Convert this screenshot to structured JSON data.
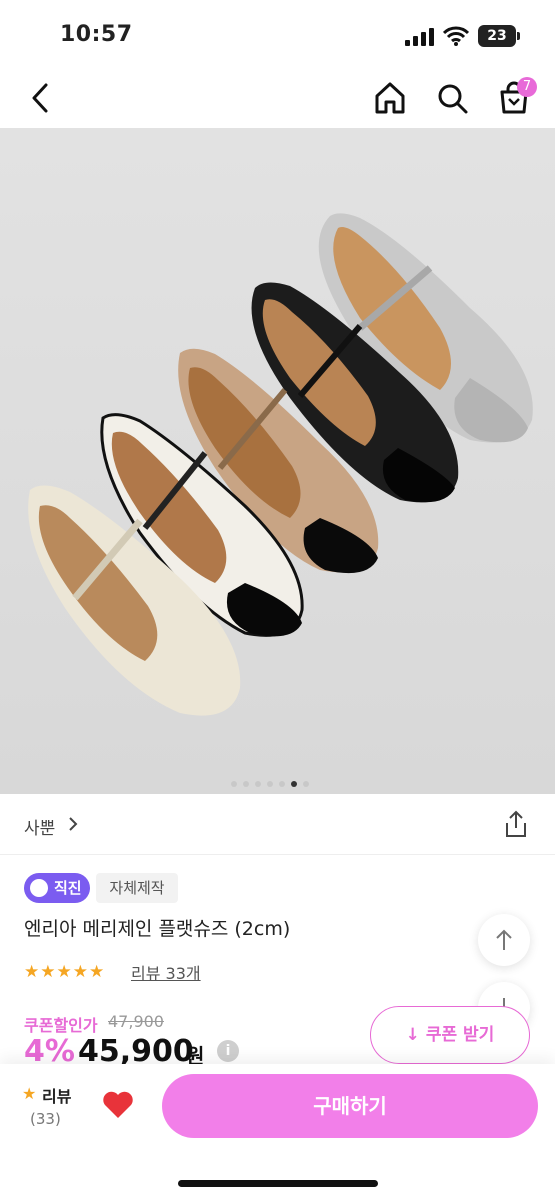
{
  "status_bar": {
    "time": "10:57",
    "battery": "23"
  },
  "nav": {
    "cart_count": "7"
  },
  "gallery": {
    "dot_count": 7,
    "active_index": 5
  },
  "brand": {
    "name": "사뿐"
  },
  "tags": {
    "direct": "직진",
    "own_made": "자체제작"
  },
  "product": {
    "title": "엔리아 메리제인 플랫슈즈 (2cm)",
    "rating_stars": 5,
    "review_link": "리뷰 33개",
    "coupon_label": "쿠폰할인가",
    "original_price": "47,900",
    "discount": "4%",
    "price": "45,900",
    "currency": "원",
    "coupon_button": "쿠폰 받기"
  },
  "bottom_bar": {
    "review_label": "리뷰",
    "review_count": "(33)",
    "buy_button": "구매하기"
  },
  "colors": {
    "accent": "#e76ad5",
    "buy": "#f27fe9",
    "badge": "#7b5cf0",
    "star": "#f5a623"
  }
}
